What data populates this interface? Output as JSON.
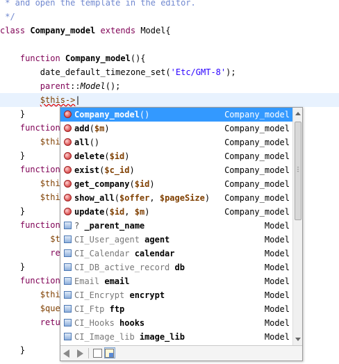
{
  "editor": {
    "code_lines": [
      [
        {
          "t": " * and open the template in the editor.",
          "c": "cm"
        }
      ],
      [
        {
          "t": " */",
          "c": "cm"
        }
      ],
      [
        {
          "t": "class ",
          "c": "kw"
        },
        {
          "t": "Company_model",
          "c": "kwb"
        },
        {
          "t": " extends ",
          "c": "kw"
        },
        {
          "t": "Model{",
          "c": ""
        }
      ],
      [],
      [
        {
          "t": "    function ",
          "c": "kw"
        },
        {
          "t": "Company_model",
          "c": "kwb"
        },
        {
          "t": "(){",
          "c": ""
        }
      ],
      [
        {
          "t": "        date_default_timezone_set(",
          "c": ""
        },
        {
          "t": "'Etc/GMT-8'",
          "c": "str"
        },
        {
          "t": ");",
          "c": ""
        }
      ],
      [
        {
          "t": "        parent",
          "c": "kw"
        },
        {
          "t": "::",
          "c": ""
        },
        {
          "t": "Model",
          "c": "ital"
        },
        {
          "t": "();",
          "c": ""
        }
      ],
      [
        {
          "t": "        ",
          "c": ""
        },
        {
          "t": "$this->",
          "c": "var squiggle"
        },
        {
          "t": "|",
          "c": ""
        }
      ],
      [
        {
          "t": "    }",
          "c": ""
        }
      ],
      [
        {
          "t": "    function",
          "c": "kw"
        }
      ],
      [
        {
          "t": "        $thi",
          "c": "var"
        }
      ],
      [
        {
          "t": "    }",
          "c": ""
        }
      ],
      [
        {
          "t": "    function",
          "c": "kw"
        }
      ],
      [
        {
          "t": "        $thi",
          "c": "var"
        }
      ],
      [
        {
          "t": "        $thi",
          "c": "var"
        }
      ],
      [
        {
          "t": "    }",
          "c": ""
        }
      ],
      [
        {
          "t": "    function",
          "c": "kw"
        }
      ],
      [
        {
          "t": "          $t",
          "c": "var"
        }
      ],
      [
        {
          "t": "          ret",
          "c": "kw"
        }
      ],
      [
        {
          "t": "    }",
          "c": ""
        }
      ],
      [
        {
          "t": "    function",
          "c": "kw"
        }
      ],
      [
        {
          "t": "        $thi",
          "c": "var"
        }
      ],
      [
        {
          "t": "        $que",
          "c": "var"
        }
      ],
      [
        {
          "t": "        retu",
          "c": "kw"
        }
      ],
      [],
      [
        {
          "t": "    }",
          "c": ""
        }
      ]
    ]
  },
  "autocomplete": {
    "items": [
      {
        "kind": "method",
        "parts": [
          {
            "t": "Company_model",
            "c": "nm"
          },
          {
            "t": "()",
            "c": ""
          }
        ],
        "type": "Company_model",
        "selected": true
      },
      {
        "kind": "method",
        "parts": [
          {
            "t": "add",
            "c": "nm"
          },
          {
            "t": "(",
            "c": ""
          },
          {
            "t": "$m",
            "c": "pv"
          },
          {
            "t": ")",
            "c": ""
          }
        ],
        "type": "Company_model"
      },
      {
        "kind": "method",
        "parts": [
          {
            "t": "all",
            "c": "nm"
          },
          {
            "t": "()",
            "c": ""
          }
        ],
        "type": "Company_model"
      },
      {
        "kind": "method",
        "parts": [
          {
            "t": "delete",
            "c": "nm"
          },
          {
            "t": "(",
            "c": ""
          },
          {
            "t": "$id",
            "c": "pv"
          },
          {
            "t": ")",
            "c": ""
          }
        ],
        "type": "Company_model"
      },
      {
        "kind": "method",
        "parts": [
          {
            "t": "exist",
            "c": "nm"
          },
          {
            "t": "(",
            "c": ""
          },
          {
            "t": "$c_id",
            "c": "pv"
          },
          {
            "t": ")",
            "c": ""
          }
        ],
        "type": "Company_model"
      },
      {
        "kind": "method",
        "parts": [
          {
            "t": "get_company",
            "c": "nm"
          },
          {
            "t": "(",
            "c": ""
          },
          {
            "t": "$id",
            "c": "pv"
          },
          {
            "t": ")",
            "c": ""
          }
        ],
        "type": "Company_model"
      },
      {
        "kind": "method",
        "parts": [
          {
            "t": "show_all",
            "c": "nm"
          },
          {
            "t": "(",
            "c": ""
          },
          {
            "t": "$offer",
            "c": "pv"
          },
          {
            "t": ", ",
            "c": ""
          },
          {
            "t": "$pageSize",
            "c": "pv"
          },
          {
            "t": ")",
            "c": ""
          }
        ],
        "type": "Company_model"
      },
      {
        "kind": "method",
        "parts": [
          {
            "t": "update",
            "c": "nm"
          },
          {
            "t": "(",
            "c": ""
          },
          {
            "t": "$id",
            "c": "pv"
          },
          {
            "t": ", ",
            "c": ""
          },
          {
            "t": "$m",
            "c": "pv"
          },
          {
            "t": ")",
            "c": ""
          }
        ],
        "type": "Company_model"
      },
      {
        "kind": "field",
        "parts": [
          {
            "t": "? ",
            "c": "qm"
          },
          {
            "t": "_parent_name",
            "c": "nm"
          }
        ],
        "type": "Model"
      },
      {
        "kind": "field",
        "parts": [
          {
            "t": "CI_User_agent ",
            "c": "cls"
          },
          {
            "t": "agent",
            "c": "nm"
          }
        ],
        "type": "Model"
      },
      {
        "kind": "field",
        "parts": [
          {
            "t": "CI_Calendar ",
            "c": "cls"
          },
          {
            "t": "calendar",
            "c": "nm"
          }
        ],
        "type": "Model"
      },
      {
        "kind": "field",
        "parts": [
          {
            "t": "CI_DB_active_record ",
            "c": "cls"
          },
          {
            "t": "db",
            "c": "nm"
          }
        ],
        "type": "Model"
      },
      {
        "kind": "field",
        "parts": [
          {
            "t": "Email ",
            "c": "cls"
          },
          {
            "t": "email",
            "c": "nm"
          }
        ],
        "type": "Model"
      },
      {
        "kind": "field",
        "parts": [
          {
            "t": "CI_Encrypt ",
            "c": "cls"
          },
          {
            "t": "encrypt",
            "c": "nm"
          }
        ],
        "type": "Model"
      },
      {
        "kind": "field",
        "parts": [
          {
            "t": "CI_Ftp ",
            "c": "cls"
          },
          {
            "t": "ftp",
            "c": "nm"
          }
        ],
        "type": "Model"
      },
      {
        "kind": "field",
        "parts": [
          {
            "t": "CI_Hooks ",
            "c": "cls"
          },
          {
            "t": "hooks",
            "c": "nm"
          }
        ],
        "type": "Model"
      },
      {
        "kind": "field",
        "parts": [
          {
            "t": "CI_Image_lib ",
            "c": "cls"
          },
          {
            "t": "image_lib",
            "c": "nm"
          }
        ],
        "type": "Model"
      }
    ],
    "scroll_position": 0.0,
    "toolbar": {
      "icons": [
        "back-arrow-icon",
        "forward-arrow-icon",
        "documentation-icon",
        "source-icon"
      ]
    }
  }
}
